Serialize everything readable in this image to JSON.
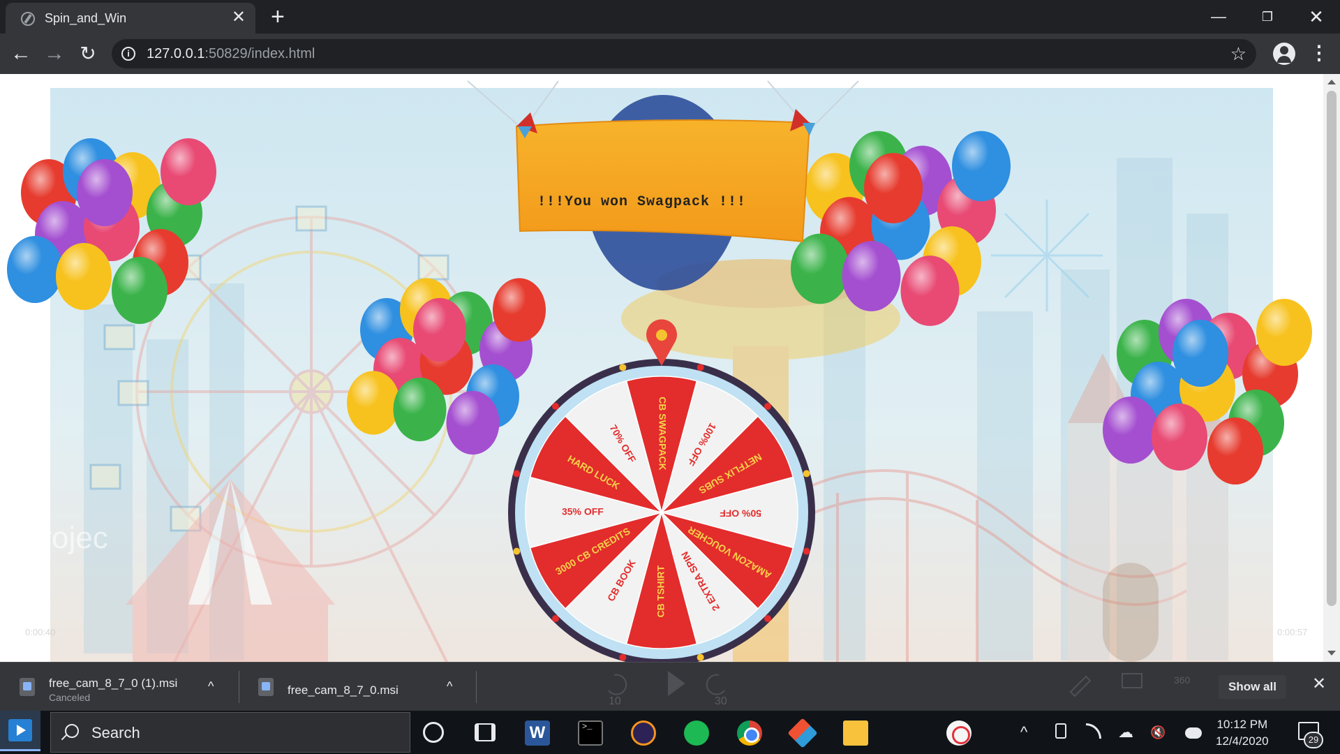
{
  "browser": {
    "tab_title": "Spin_and_Win",
    "tab_close": "✕",
    "new_tab": "+",
    "window_controls": {
      "minimize": "—",
      "restore": "❐",
      "close": "✕"
    },
    "nav": {
      "back": "←",
      "forward": "→",
      "reload": "↻"
    },
    "url_host": "127.0.0.1",
    "url_rest": ":50829/index.html",
    "star": "☆",
    "menu": "⋮"
  },
  "page": {
    "banner_text": "!!!You won Swagpack !!!",
    "watermark": "Projec",
    "player_time_left": "0:00:40",
    "player_time_right": "0:00:57",
    "wheel": {
      "segments": [
        {
          "label": "CB SWAGPACK",
          "color": "#e32c2c"
        },
        {
          "label": "100% OFF",
          "color": "#f2f2f2"
        },
        {
          "label": "NETFLIX SUBS",
          "color": "#e32c2c"
        },
        {
          "label": "50% OFF",
          "color": "#f2f2f2"
        },
        {
          "label": "AMAZON VOUCHER",
          "color": "#e32c2c"
        },
        {
          "label": "2 EXTRA SPIN",
          "color": "#f2f2f2"
        },
        {
          "label": "CB TSHIRT",
          "color": "#e32c2c"
        },
        {
          "label": "CB BOOK",
          "color": "#f2f2f2"
        },
        {
          "label": "3000 CB CREDITS",
          "color": "#e32c2c"
        },
        {
          "label": "35% OFF",
          "color": "#f2f2f2"
        },
        {
          "label": "HARD LUCK",
          "color": "#e32c2c"
        },
        {
          "label": "70% OFF",
          "color": "#f2f2f2"
        }
      ],
      "rim_color": "#3a2f4a",
      "pointer_color": "#e8453c"
    },
    "player_controls": {
      "rewind": "10",
      "forward": "30",
      "vr": "360"
    }
  },
  "downloads": {
    "items": [
      {
        "name": "free_cam_8_7_0 (1).msi",
        "status": "Canceled"
      },
      {
        "name": "free_cam_8_7_0.msi",
        "status": ""
      }
    ],
    "caret": "^",
    "show_all": "Show all",
    "close": "✕"
  },
  "taskbar": {
    "search_placeholder": "Search",
    "terminal_glyph": ">_",
    "word_glyph": "W",
    "time": "10:12 PM",
    "date": "12/4/2020",
    "notification_count": "29",
    "tray": {
      "chevron": "^",
      "volume": "🔇",
      "cloud": "☁"
    }
  }
}
